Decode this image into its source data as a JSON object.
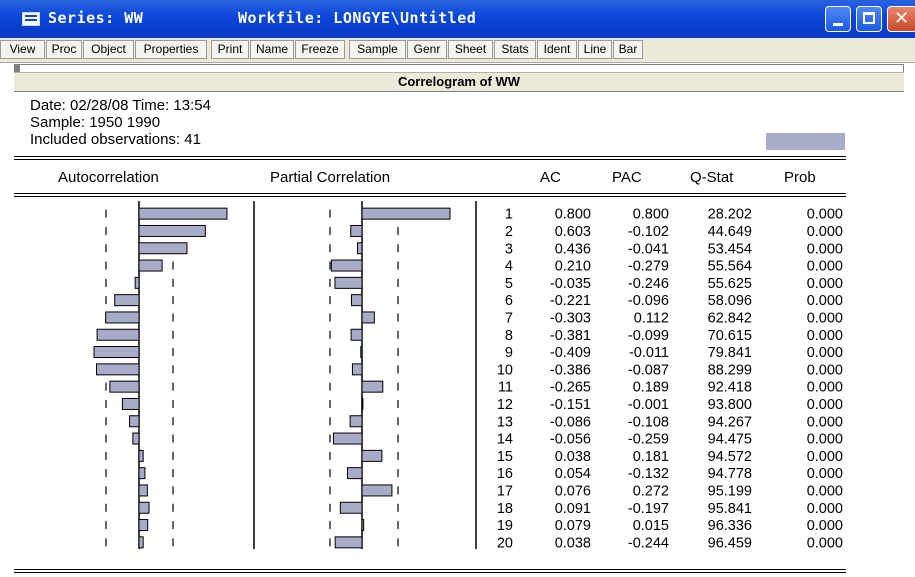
{
  "window": {
    "title_series": "Series: WW",
    "title_workfile": "Workfile: LONGYE\\Untitled"
  },
  "toolbar": {
    "buttons": [
      "View",
      "Proc",
      "Object",
      "Properties",
      "Print",
      "Name",
      "Freeze",
      "Sample",
      "Genr",
      "Sheet",
      "Stats",
      "Ident",
      "Line",
      "Bar"
    ]
  },
  "view": {
    "heading": "Correlogram of WW",
    "date_line": "Date: 02/28/08   Time: 13:54",
    "sample_line": "Sample: 1950 1990",
    "obs_line": "Included observations: 41",
    "columns": {
      "autocorrelation": "Autocorrelation",
      "partial": "Partial Correlation",
      "ac": "AC",
      "pac": "PAC",
      "qstat": "Q-Stat",
      "prob": "Prob"
    }
  },
  "colors": {
    "title_bar": "#0a46d8",
    "bar_fill": "#a9acc9",
    "toolbar_bg": "#ece9d8"
  },
  "correlogram": {
    "rows": [
      {
        "lag": "1",
        "ac": "0.800",
        "pac": "0.800",
        "q": "28.202",
        "prob": "0.000"
      },
      {
        "lag": "2",
        "ac": "0.603",
        "pac": "-0.102",
        "q": "44.649",
        "prob": "0.000"
      },
      {
        "lag": "3",
        "ac": "0.436",
        "pac": "-0.041",
        "q": "53.454",
        "prob": "0.000"
      },
      {
        "lag": "4",
        "ac": "0.210",
        "pac": "-0.279",
        "q": "55.564",
        "prob": "0.000"
      },
      {
        "lag": "5",
        "ac": "-0.035",
        "pac": "-0.246",
        "q": "55.625",
        "prob": "0.000"
      },
      {
        "lag": "6",
        "ac": "-0.221",
        "pac": "-0.096",
        "q": "58.096",
        "prob": "0.000"
      },
      {
        "lag": "7",
        "ac": "-0.303",
        "pac": "0.112",
        "q": "62.842",
        "prob": "0.000"
      },
      {
        "lag": "8",
        "ac": "-0.381",
        "pac": "-0.099",
        "q": "70.615",
        "prob": "0.000"
      },
      {
        "lag": "9",
        "ac": "-0.409",
        "pac": "-0.011",
        "q": "79.841",
        "prob": "0.000"
      },
      {
        "lag": "10",
        "ac": "-0.386",
        "pac": "-0.087",
        "q": "88.299",
        "prob": "0.000"
      },
      {
        "lag": "11",
        "ac": "-0.265",
        "pac": "0.189",
        "q": "92.418",
        "prob": "0.000"
      },
      {
        "lag": "12",
        "ac": "-0.151",
        "pac": "-0.001",
        "q": "93.800",
        "prob": "0.000"
      },
      {
        "lag": "13",
        "ac": "-0.086",
        "pac": "-0.108",
        "q": "94.267",
        "prob": "0.000"
      },
      {
        "lag": "14",
        "ac": "-0.056",
        "pac": "-0.259",
        "q": "94.475",
        "prob": "0.000"
      },
      {
        "lag": "15",
        "ac": "0.038",
        "pac": "0.181",
        "q": "94.572",
        "prob": "0.000"
      },
      {
        "lag": "16",
        "ac": "0.054",
        "pac": "-0.132",
        "q": "94.778",
        "prob": "0.000"
      },
      {
        "lag": "17",
        "ac": "0.076",
        "pac": "0.272",
        "q": "95.199",
        "prob": "0.000"
      },
      {
        "lag": "18",
        "ac": "0.091",
        "pac": "-0.197",
        "q": "95.841",
        "prob": "0.000"
      },
      {
        "lag": "19",
        "ac": "0.079",
        "pac": "0.015",
        "q": "96.336",
        "prob": "0.000"
      },
      {
        "lag": "20",
        "ac": "0.038",
        "pac": "-0.244",
        "q": "96.459",
        "prob": "0.000"
      }
    ]
  }
}
